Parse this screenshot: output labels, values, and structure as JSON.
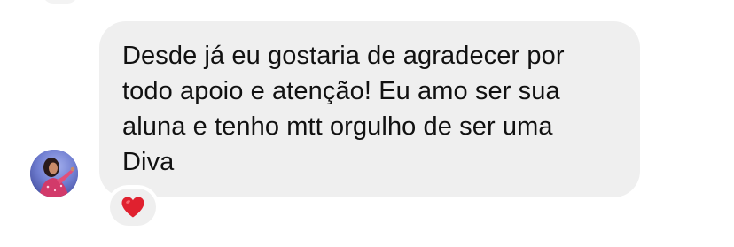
{
  "message": {
    "text": "Desde já eu gostaria de agradecer por\ntodo apoio e atenção! Eu amo ser sua\naluna e tenho mtt orgulho de ser uma\nDiva",
    "bubble_color": "#efefef",
    "text_color": "#111111"
  },
  "reaction": {
    "icon": "red-heart-icon",
    "color": "#e0212f"
  },
  "avatar": {
    "icon": "profile-photo"
  }
}
